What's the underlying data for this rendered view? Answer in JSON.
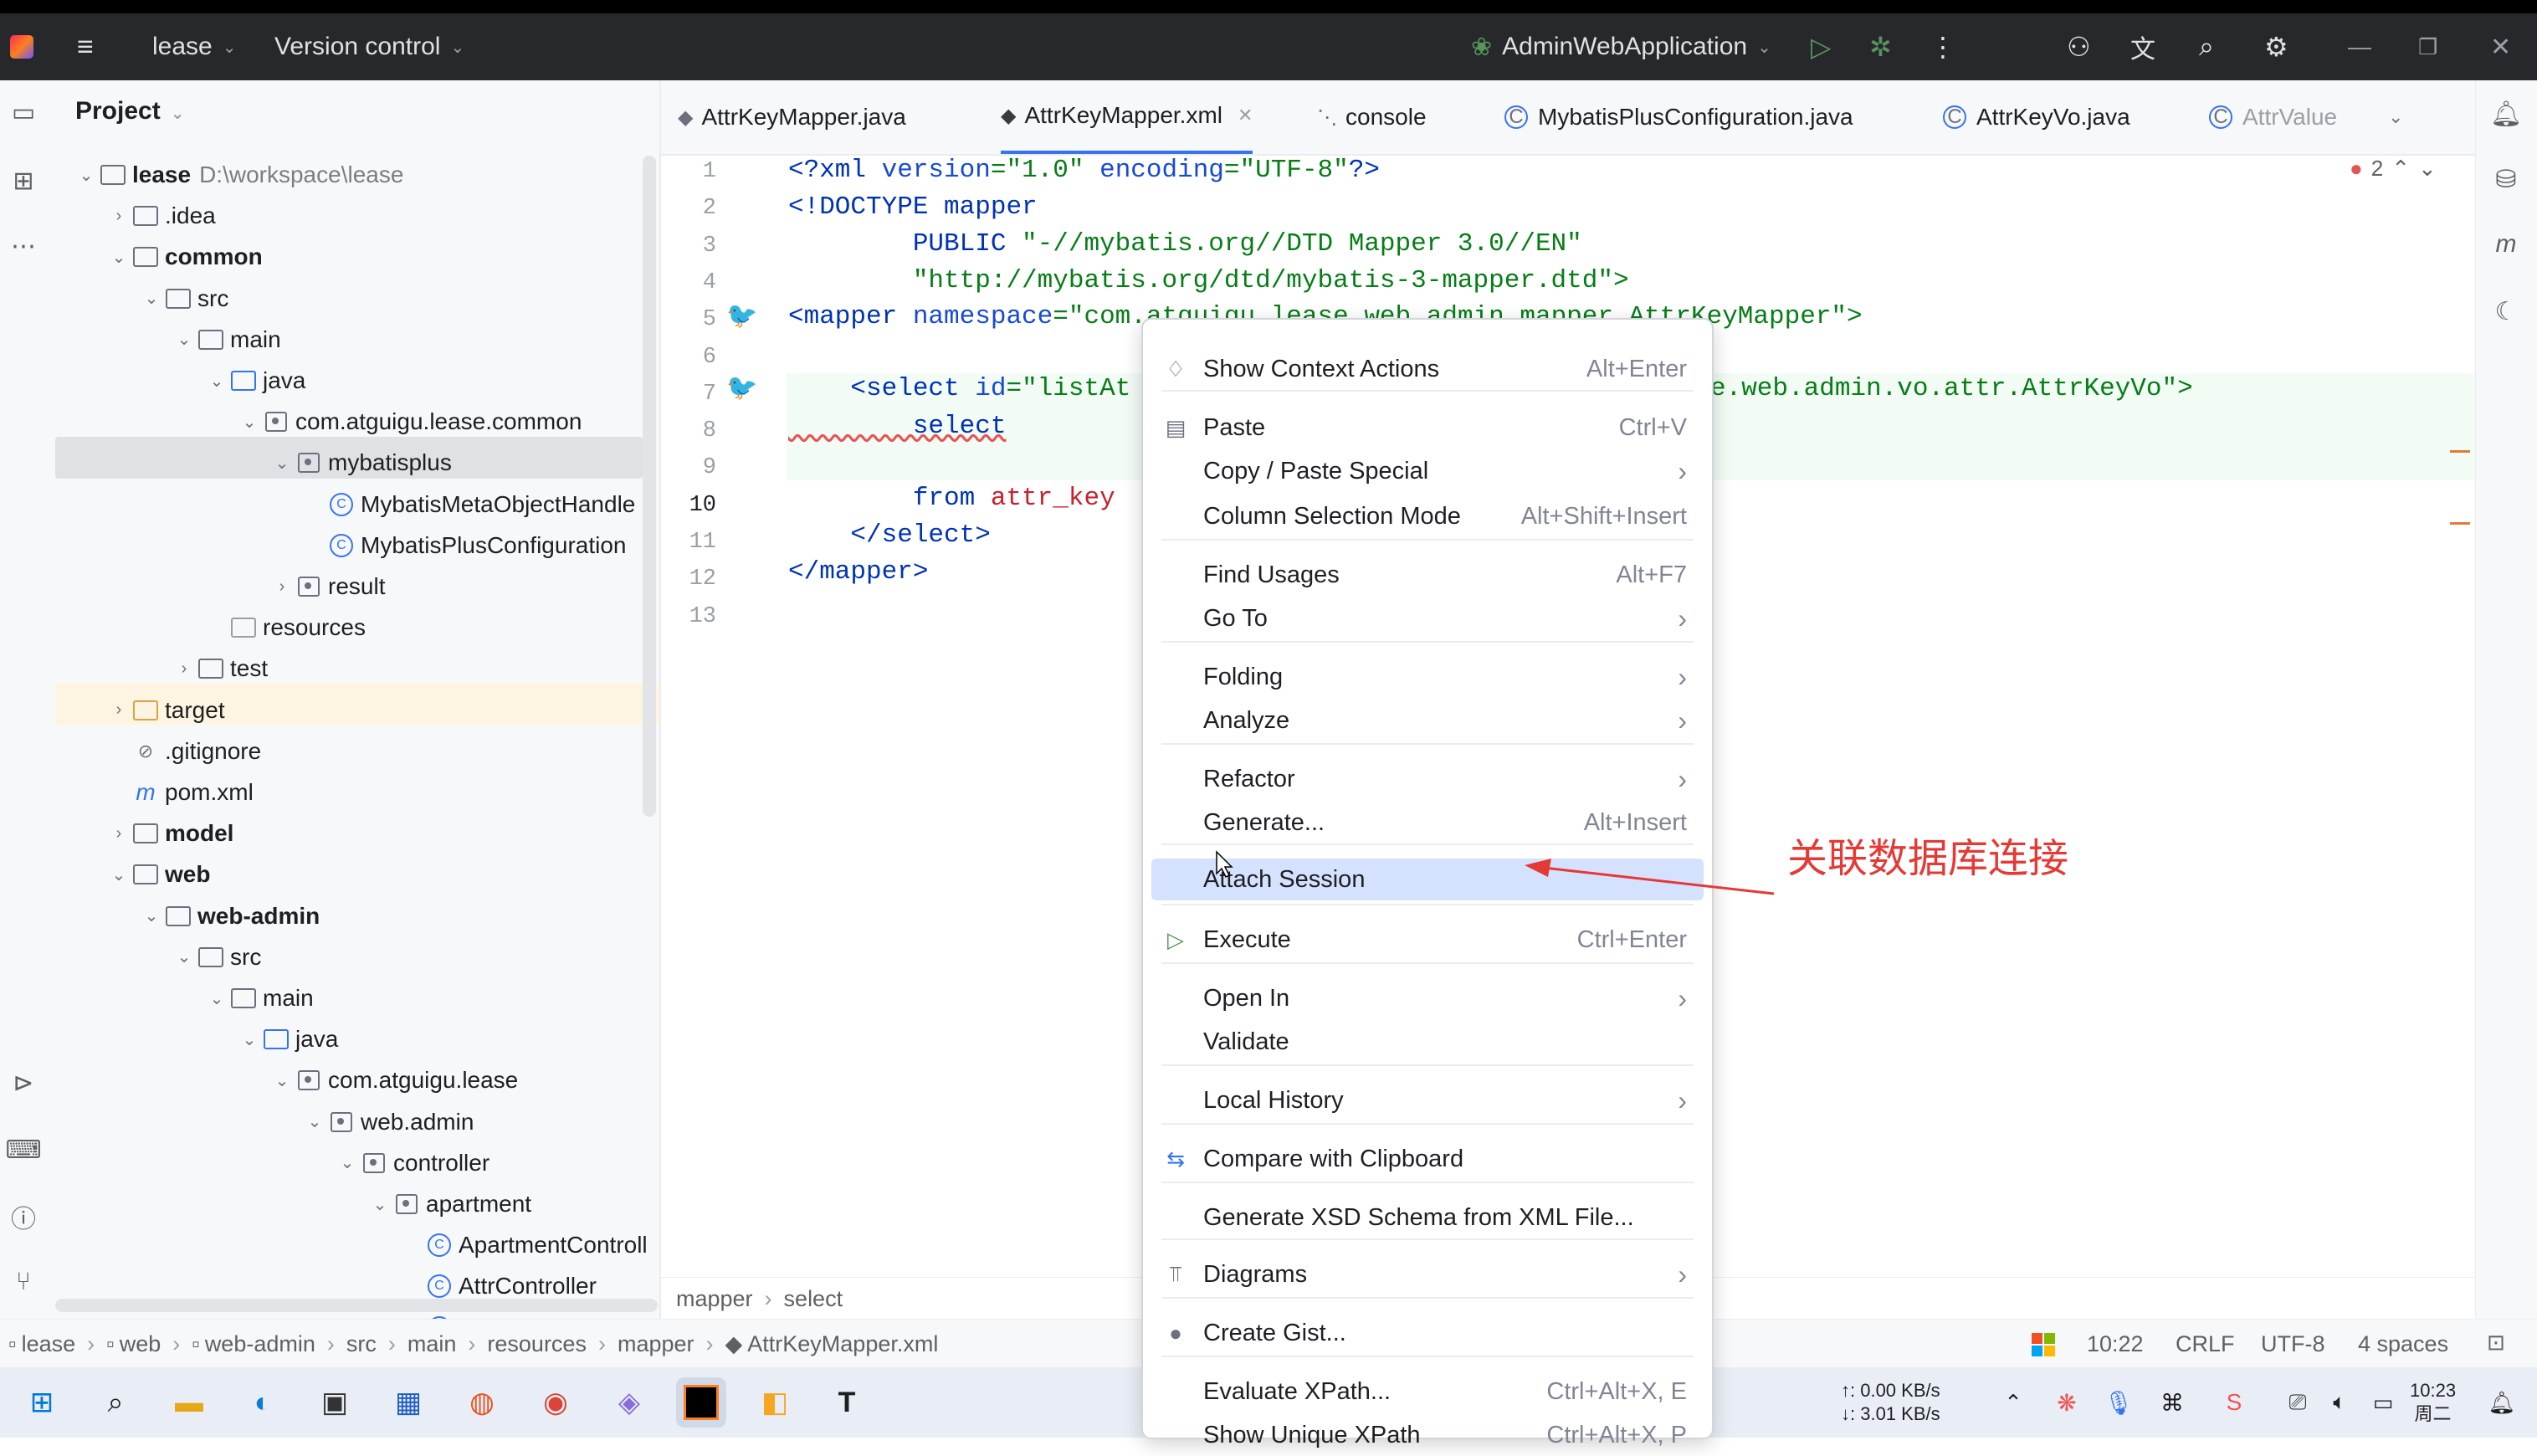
{
  "titlebar": {
    "project": "lease",
    "vcs": "Version control",
    "run_config": "AdminWebApplication"
  },
  "project_panel": {
    "title": "Project",
    "tree": [
      {
        "label": "lease",
        "path": "D:\\workspace\\lease"
      },
      {
        "label": ".idea"
      },
      {
        "label": "common"
      },
      {
        "label": "src"
      },
      {
        "label": "main"
      },
      {
        "label": "java"
      },
      {
        "label": "com.atguigu.lease.common"
      },
      {
        "label": "mybatisplus"
      },
      {
        "label": "MybatisMetaObjectHandle"
      },
      {
        "label": "MybatisPlusConfiguration"
      },
      {
        "label": "result"
      },
      {
        "label": "resources"
      },
      {
        "label": "test"
      },
      {
        "label": "target"
      },
      {
        "label": ".gitignore"
      },
      {
        "label": "pom.xml"
      },
      {
        "label": "model"
      },
      {
        "label": "web"
      },
      {
        "label": "web-admin"
      },
      {
        "label": "src"
      },
      {
        "label": "main"
      },
      {
        "label": "java"
      },
      {
        "label": "com.atguigu.lease"
      },
      {
        "label": "web.admin"
      },
      {
        "label": "controller"
      },
      {
        "label": "apartment"
      },
      {
        "label": "ApartmentControll"
      },
      {
        "label": "AttrController"
      },
      {
        "label": "FacilityController"
      }
    ]
  },
  "tabs": [
    {
      "label": "AttrKeyMapper.java"
    },
    {
      "label": "AttrKeyMapper.xml"
    },
    {
      "label": "console"
    },
    {
      "label": "MybatisPlusConfiguration.java"
    },
    {
      "label": "AttrKeyVo.java"
    },
    {
      "label": "AttrValue"
    }
  ],
  "editor": {
    "line_numbers": [
      "1",
      "2",
      "3",
      "4",
      "5",
      "6",
      "7",
      "8",
      "9",
      "10",
      "11",
      "12",
      "13"
    ],
    "problems_count": "2",
    "lines": {
      "l1a": "<?xml ",
      "l1b": "version",
      "l1c": "=",
      "l1d": "\"1.0\"",
      "l1e": " encoding",
      "l1f": "=",
      "l1g": "\"UTF-8\"",
      "l1h": "?>",
      "l2": "<!DOCTYPE mapper",
      "l3a": "        PUBLIC ",
      "l3b": "\"-//mybatis.org//DTD Mapper 3.0//EN\"",
      "l4": "        \"http://mybatis.org/dtd/mybatis-3-mapper.dtd\">",
      "l5a": "<mapper ",
      "l5b": "namespace",
      "l5c": "=\"com.atguigu.lease.web.admin.mapper.AttrKeyMapper\">",
      "l7a": "    <select ",
      "l7b": "id",
      "l7c": "=\"listAt",
      "l7tail": "e.web.admin.vo.attr.AttrKeyVo\">",
      "l8": "        select",
      "l10a": "        from ",
      "l10b": "attr_key",
      "l11": "    </select>",
      "l12": "</mapper>"
    }
  },
  "breadcrumb": [
    "mapper",
    "select"
  ],
  "status": {
    "path": [
      "lease",
      "web",
      "web-admin",
      "src",
      "main",
      "resources",
      "mapper",
      "AttrKeyMapper.xml"
    ],
    "position": "10:22",
    "line_sep": "CRLF",
    "encoding": "UTF-8",
    "indent": "4 spaces"
  },
  "context_menu": {
    "items": [
      {
        "label": "Show Context Actions",
        "shortcut": "Alt+Enter"
      },
      {
        "label": "Paste",
        "shortcut": "Ctrl+V"
      },
      {
        "label": "Copy / Paste Special",
        "shortcut": "›"
      },
      {
        "label": "Column Selection Mode",
        "shortcut": "Alt+Shift+Insert"
      },
      {
        "label": "Find Usages",
        "shortcut": "Alt+F7"
      },
      {
        "label": "Go To",
        "shortcut": "›"
      },
      {
        "label": "Folding",
        "shortcut": "›"
      },
      {
        "label": "Analyze",
        "shortcut": "›"
      },
      {
        "label": "Refactor",
        "shortcut": "›"
      },
      {
        "label": "Generate...",
        "shortcut": "Alt+Insert"
      },
      {
        "label": "Attach Session",
        "shortcut": ""
      },
      {
        "label": "Execute",
        "shortcut": "Ctrl+Enter"
      },
      {
        "label": "Open In",
        "shortcut": "›"
      },
      {
        "label": "Validate",
        "shortcut": ""
      },
      {
        "label": "Local History",
        "shortcut": "›"
      },
      {
        "label": "Compare with Clipboard",
        "shortcut": ""
      },
      {
        "label": "Generate XSD Schema from XML File...",
        "shortcut": ""
      },
      {
        "label": "Diagrams",
        "shortcut": "›"
      },
      {
        "label": "Create Gist...",
        "shortcut": ""
      },
      {
        "label": "Evaluate XPath...",
        "shortcut": "Ctrl+Alt+X, E"
      },
      {
        "label": "Show Unique XPath",
        "shortcut": "Ctrl+Alt+X, P"
      }
    ]
  },
  "annotation": "关联数据库连接",
  "taskbar": {
    "net_up": "↑: 0.00 KB/s",
    "net_down": "↓: 3.01 KB/s",
    "time": "10:23",
    "day": "周二"
  },
  "colors": {
    "accent": "#3574f0",
    "annotation": "#e53935",
    "selection": "#d4e2ff"
  }
}
